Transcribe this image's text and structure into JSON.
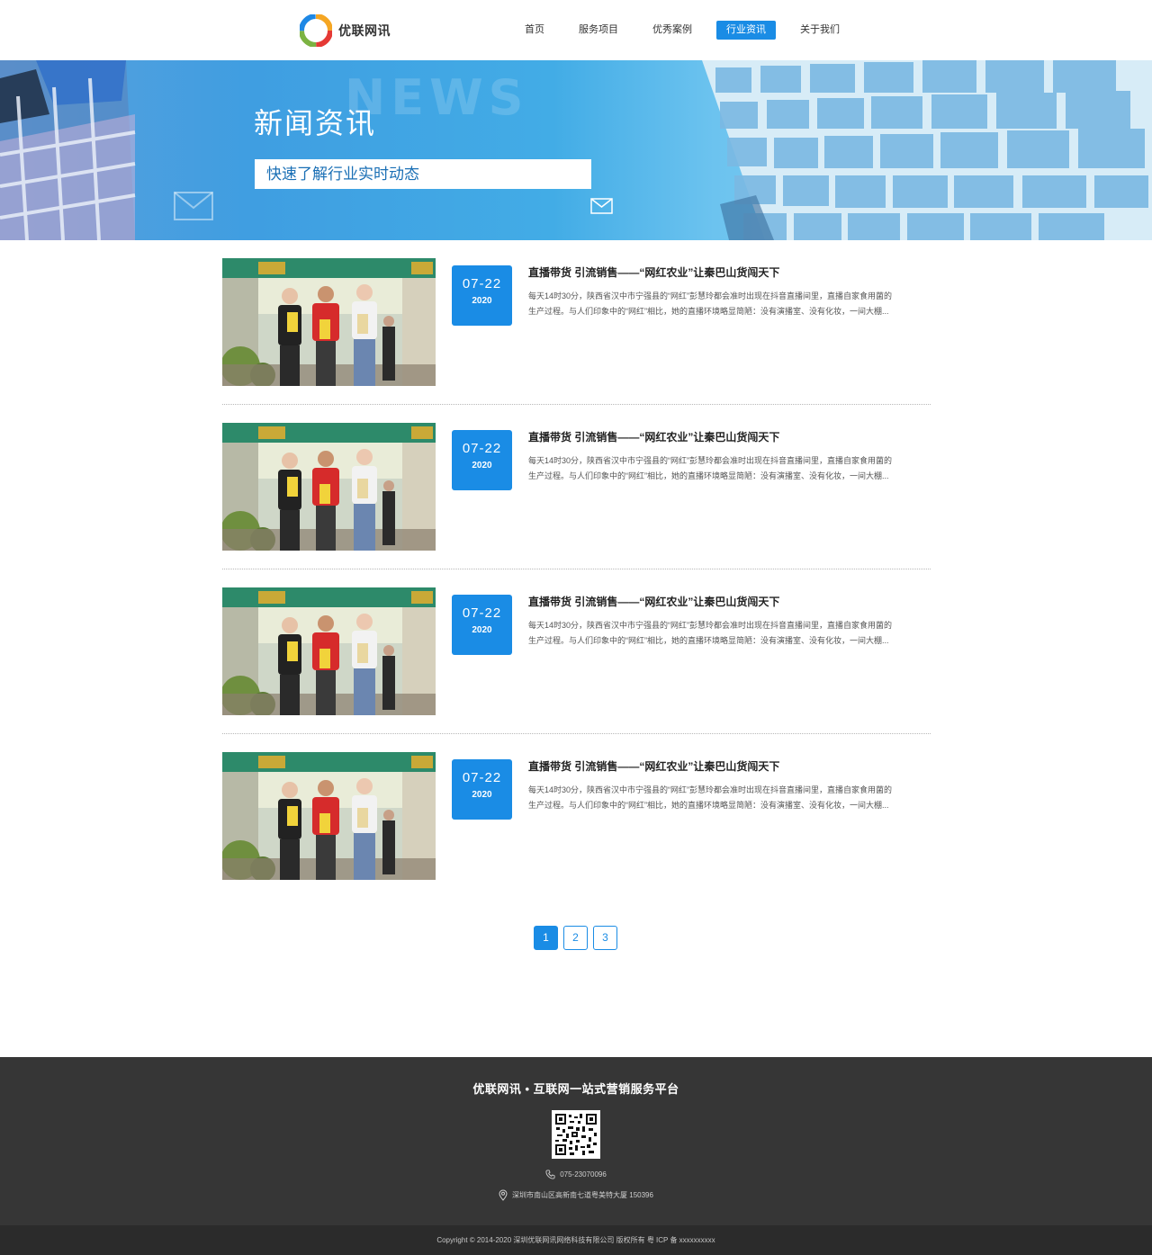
{
  "header": {
    "logo_text": "优联网讯",
    "nav": [
      {
        "label": "首页"
      },
      {
        "label": "服务项目"
      },
      {
        "label": "优秀案例"
      },
      {
        "label": "行业资讯",
        "active": true
      },
      {
        "label": "关于我们"
      }
    ]
  },
  "banner": {
    "watermark": "NEWS",
    "title": "新闻资讯",
    "subtitle": "快速了解行业实时动态"
  },
  "news": [
    {
      "date_md": "07-22",
      "year": "2020",
      "title": "直播带货 引流销售——“网红农业”让秦巴山货闯天下",
      "excerpt": "每天14时30分，陕西省汉中市宁强县的“网红”彭慧玲都会准时出现在抖音直播间里，直播自家食用菌的生产过程。与人们印象中的“网红”相比，她的直播环境略显简陋：没有演播室、没有化妆，一间大棚..."
    },
    {
      "date_md": "07-22",
      "year": "2020",
      "title": "直播带货 引流销售——“网红农业”让秦巴山货闯天下",
      "excerpt": "每天14时30分，陕西省汉中市宁强县的“网红”彭慧玲都会准时出现在抖音直播间里，直播自家食用菌的生产过程。与人们印象中的“网红”相比，她的直播环境略显简陋：没有演播室、没有化妆，一间大棚..."
    },
    {
      "date_md": "07-22",
      "year": "2020",
      "title": "直播带货 引流销售——“网红农业”让秦巴山货闯天下",
      "excerpt": "每天14时30分，陕西省汉中市宁强县的“网红”彭慧玲都会准时出现在抖音直播间里，直播自家食用菌的生产过程。与人们印象中的“网红”相比，她的直播环境略显简陋：没有演播室、没有化妆，一间大棚..."
    },
    {
      "date_md": "07-22",
      "year": "2020",
      "title": "直播带货 引流销售——“网红农业”让秦巴山货闯天下",
      "excerpt": "每天14时30分，陕西省汉中市宁强县的“网红”彭慧玲都会准时出现在抖音直播间里，直播自家食用菌的生产过程。与人们印象中的“网红”相比，她的直播环境略显简陋：没有演播室、没有化妆，一间大棚..."
    }
  ],
  "pagination": {
    "pages": [
      "1",
      "2",
      "3"
    ],
    "current": "1"
  },
  "footer": {
    "slogan": "优联网讯 • 互联网一站式营销服务平台",
    "phone": "075-23070096",
    "address": "深圳市南山区高新南七道粤美特大厦 150396",
    "copyright": "Copyright © 2014-2020 深圳优联网讯网络科技有限公司 版权所有 粤 ICP 备 xxxxxxxxxx"
  },
  "icons": {
    "logo": "logo-swirl-icon",
    "mail": "mail-icon",
    "phone": "phone-icon",
    "location": "location-pin-icon",
    "qr": "qr-code-icon"
  },
  "colors": {
    "accent": "#1a8ce5",
    "footer_bg": "#363636",
    "copyright_bg": "#2b2b2b"
  }
}
